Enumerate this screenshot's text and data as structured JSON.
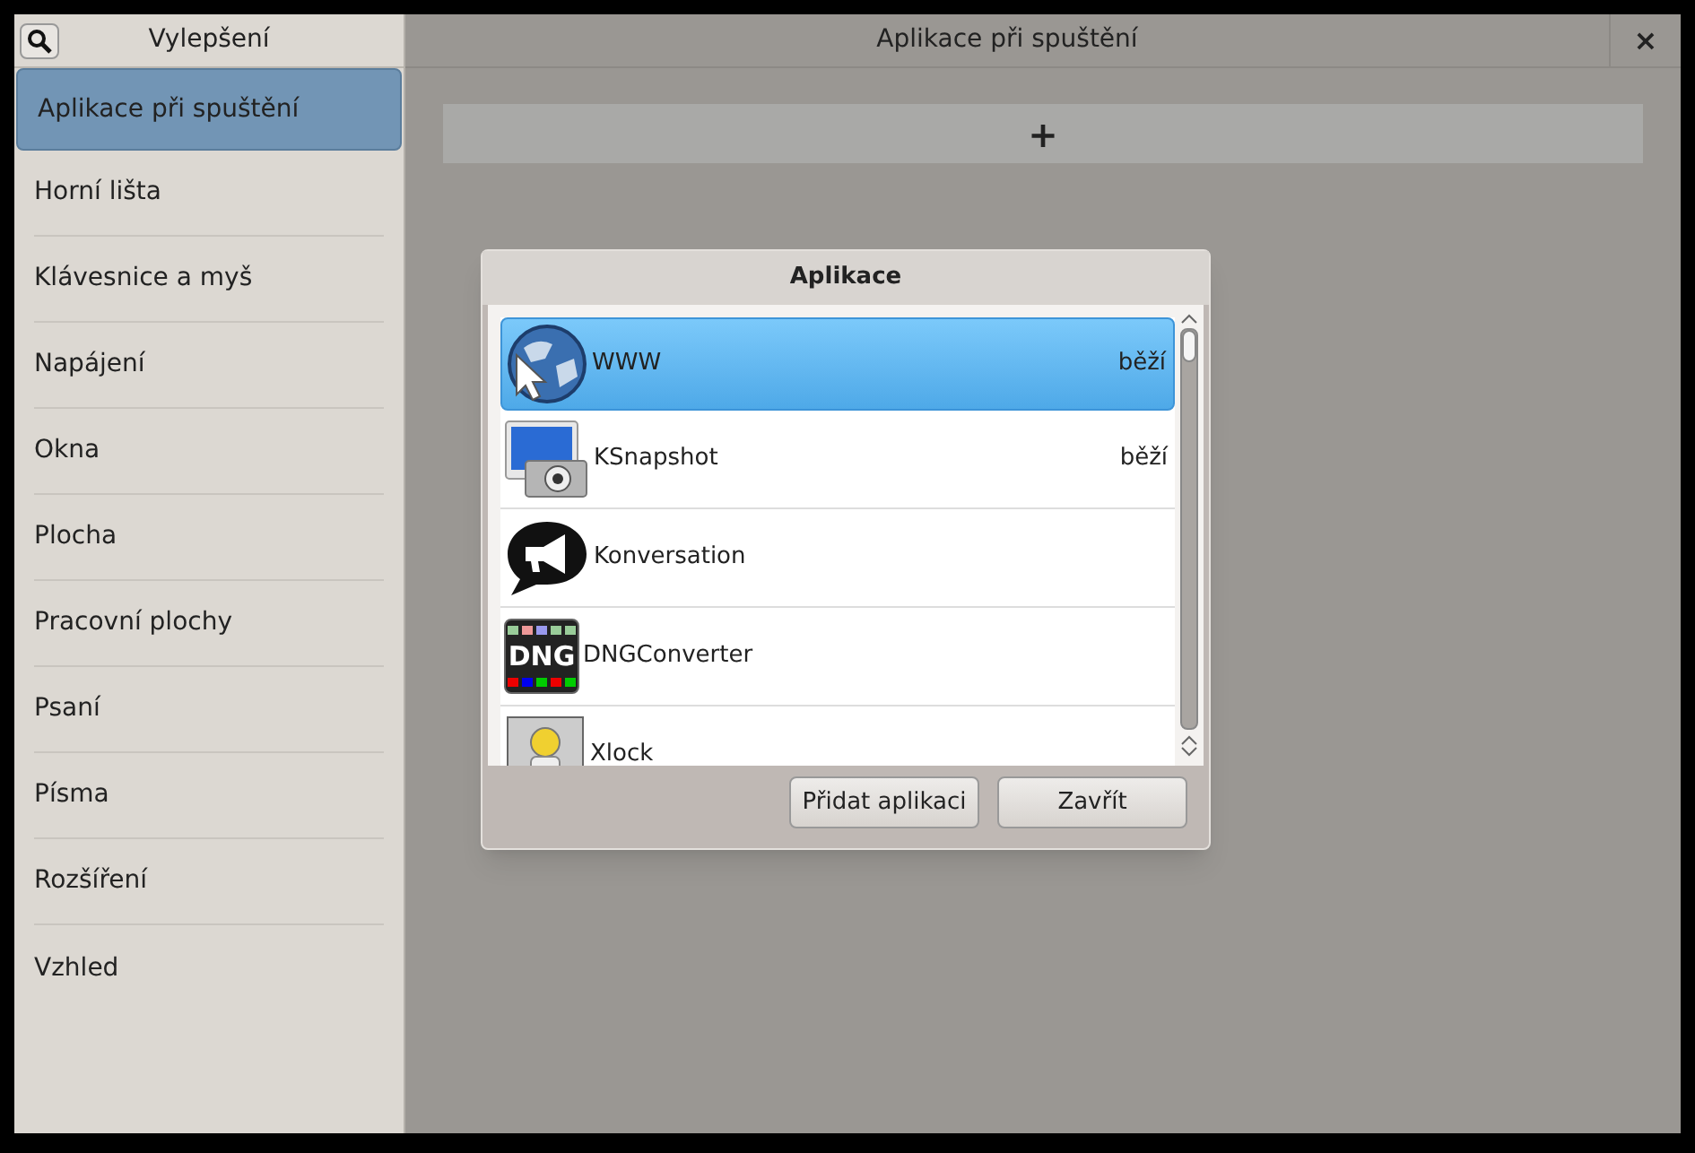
{
  "sidebar": {
    "title": "Vylepšení",
    "items": [
      {
        "label": "Aplikace při spuštění",
        "selected": true
      },
      {
        "label": "Horní lišta",
        "selected": false
      },
      {
        "label": "Klávesnice a myš",
        "selected": false
      },
      {
        "label": "Napájení",
        "selected": false
      },
      {
        "label": "Okna",
        "selected": false
      },
      {
        "label": "Plocha",
        "selected": false
      },
      {
        "label": "Pracovní plochy",
        "selected": false
      },
      {
        "label": "Psaní",
        "selected": false
      },
      {
        "label": "Písma",
        "selected": false
      },
      {
        "label": "Rozšíření",
        "selected": false
      },
      {
        "label": "Vzhled",
        "selected": false
      }
    ]
  },
  "header": {
    "title": "Aplikace při spuštění",
    "close": "×"
  },
  "add_button": "+",
  "dialog": {
    "title": "Aplikace",
    "apps": [
      {
        "name": "WWW",
        "status": "běží",
        "kind": "globe",
        "selected": true
      },
      {
        "name": "KSnapshot",
        "status": "běží",
        "kind": "camera",
        "selected": false
      },
      {
        "name": "Konversation",
        "kind": "chat",
        "selected": false
      },
      {
        "name": "DNGConverter",
        "kind": "dng",
        "icon_text": "DNG",
        "selected": false
      },
      {
        "name": "Xlock",
        "kind": "lock",
        "selected": false
      }
    ],
    "buttons": [
      "Přidat aplikaci",
      "Zavřít"
    ]
  }
}
